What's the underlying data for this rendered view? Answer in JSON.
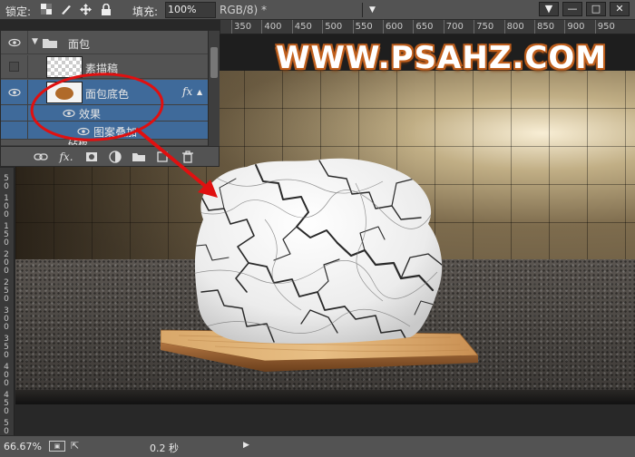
{
  "toolbar": {
    "lock_label": "锁定:",
    "fill_label": "填充:",
    "fill_value": "100%",
    "doc_tab": "RGB/8) *",
    "lock_icons": [
      "checker-icon",
      "brush-icon",
      "move-icon",
      "lock-icon"
    ]
  },
  "window_controls": [
    "▼",
    "—",
    "□",
    "✕"
  ],
  "ruler_top": [
    "350",
    "400",
    "450",
    "500",
    "550",
    "600",
    "650",
    "700",
    "750",
    "800",
    "850",
    "900",
    "950"
  ],
  "ruler_left": [
    [
      "5",
      "0"
    ],
    [
      "1",
      "0",
      "0"
    ],
    [
      "1",
      "5",
      "0"
    ],
    [
      "2",
      "0",
      "0"
    ],
    [
      "2",
      "5",
      "0"
    ],
    [
      "3",
      "0",
      "0"
    ],
    [
      "3",
      "5",
      "0"
    ],
    [
      "4",
      "0",
      "0"
    ],
    [
      "4",
      "5",
      "0"
    ],
    [
      "5",
      "0",
      "0"
    ]
  ],
  "watermark": "WWW.PSAHZ.COM",
  "layers": {
    "group_name": "面包",
    "sketch_name": "素描稿",
    "base_name": "面包底色",
    "fx_label": "fx",
    "effects_label": "效果",
    "pattern_label": "图案叠加",
    "partial_name": "砧板"
  },
  "layer_toolbar_icons": [
    "link-icon",
    "fx-icon",
    "mask-icon",
    "adjustment-icon",
    "folder-icon",
    "new-layer-icon",
    "trash-icon"
  ],
  "status": {
    "zoom": "66.67%",
    "timing": "0.2 秒"
  },
  "colors": {
    "annotation": "#e01010",
    "selected_layer": "#3f6a9a",
    "watermark_outline": "#b85c1e"
  }
}
